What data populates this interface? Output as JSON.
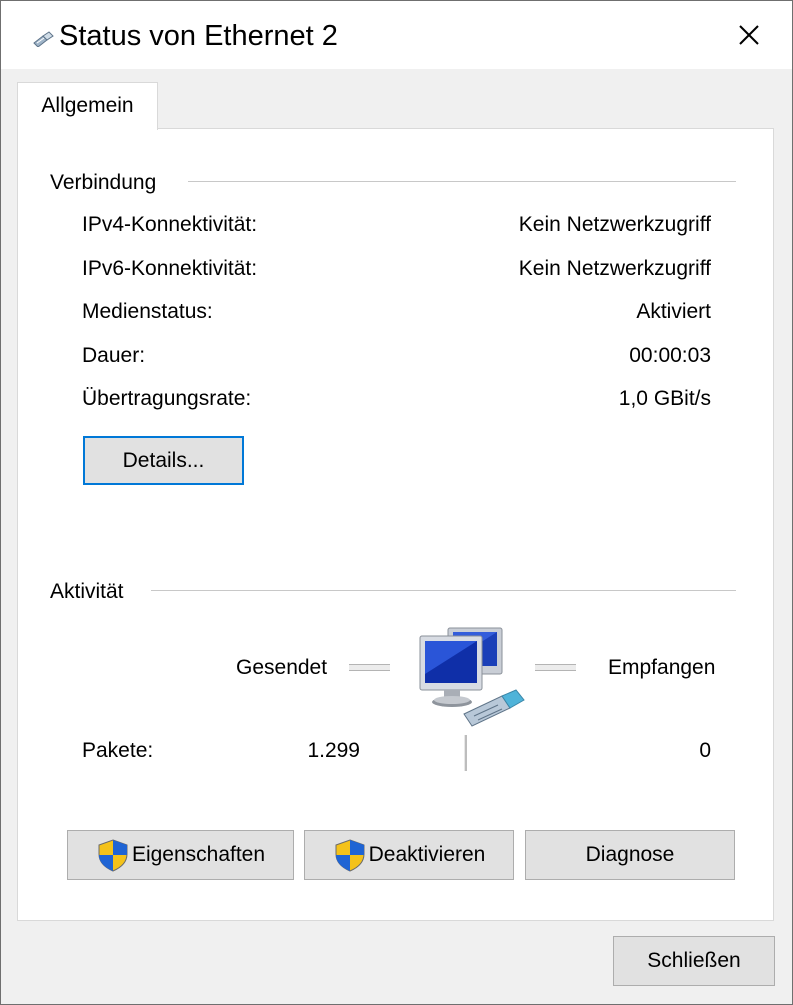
{
  "window": {
    "title": "Status von Ethernet 2",
    "close_glyph": "✕"
  },
  "tabs": [
    {
      "label": "Allgemein",
      "selected": true
    }
  ],
  "connection": {
    "heading": "Verbindung",
    "rows": [
      {
        "label": "IPv4-Konnektivität:",
        "value": "Kein Netzwerkzugriff"
      },
      {
        "label": "IPv6-Konnektivität:",
        "value": "Kein Netzwerkzugriff"
      },
      {
        "label": "Medienstatus:",
        "value": "Aktiviert"
      },
      {
        "label": "Dauer:",
        "value": "00:00:03"
      },
      {
        "label": "Übertragungsrate:",
        "value": "1,0 GBit/s"
      }
    ],
    "details_button": "Details..."
  },
  "activity": {
    "heading": "Aktivität",
    "sent_label": "Gesendet",
    "received_label": "Empfangen",
    "packets_label": "Pakete:",
    "packets_sent": "1.299",
    "packets_received": "0",
    "network_icon": "network-computers-icon"
  },
  "buttons": {
    "properties": "Eigenschaften",
    "disable": "Deaktivieren",
    "diagnose": "Diagnose",
    "close": "Schließen",
    "shield_icon": "uac-shield-icon"
  },
  "colors": {
    "focus_border": "#0078d7",
    "button_face": "#e1e1e1",
    "window_bg": "#f0f0f0"
  }
}
